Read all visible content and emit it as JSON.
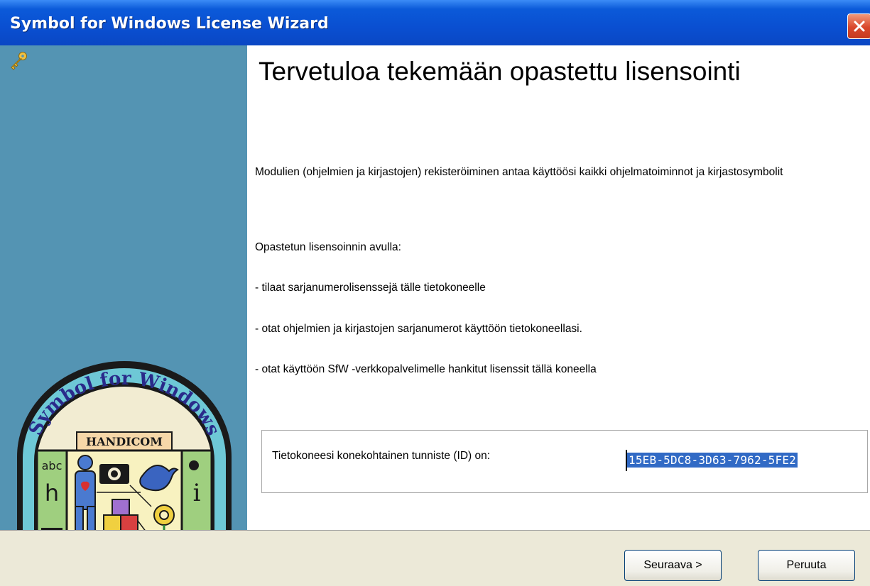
{
  "window": {
    "title": "Symbol for Windows License Wizard",
    "close_icon": "close-icon"
  },
  "sidebar": {
    "icon": "key-icon",
    "logo": {
      "line1": "Symbol for Windows",
      "line2": "HANDICOM",
      "left_text": "abc",
      "left_letter": "h",
      "right_letter": "i"
    }
  },
  "content": {
    "heading": "Tervetuloa tekemään opastettu lisensointi",
    "intro": "Modulien (ohjelmien ja kirjastojen) rekisteröiminen antaa käyttöösi kaikki ohjelmatoiminnot ja kirjastosymbolit",
    "with_help": "Opastetun lisensoinnin avulla:",
    "bullet1": "- tilaat sarjanumerolisenssejä tälle tietokoneelle",
    "bullet2": "- otat ohjelmien ja kirjastojen sarjanumerot käyttöön tietokoneellasi.",
    "bullet3": "- otat käyttöön SfW -verkkopalvelimelle hankitut lisenssit tällä koneella",
    "id_label": "Tietokoneesi konekohtainen tunniste (ID) on:",
    "id_value": "15EB-5DC8-3D63-7962-5FE2"
  },
  "footer": {
    "next_label": "Seuraava >",
    "cancel_label": "Peruuta"
  },
  "colors": {
    "titlebar": "#0a4fd1",
    "sidebar": "#5494b3",
    "footer": "#ece9d8",
    "selection": "#316ac5"
  }
}
